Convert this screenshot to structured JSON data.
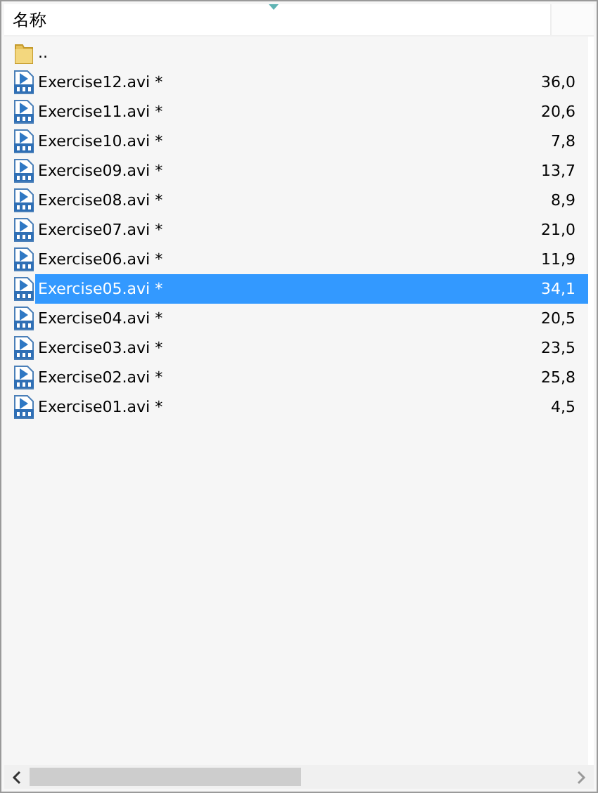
{
  "columns": [
    {
      "label": "名称"
    }
  ],
  "rows": [
    {
      "kind": "folder",
      "name": "..",
      "selected": false
    },
    {
      "kind": "video",
      "name": "Exercise12.avi *",
      "size": "36,0",
      "selected": false
    },
    {
      "kind": "video",
      "name": "Exercise11.avi *",
      "size": "20,6",
      "selected": false
    },
    {
      "kind": "video",
      "name": "Exercise10.avi *",
      "size": "7,8",
      "selected": false
    },
    {
      "kind": "video",
      "name": "Exercise09.avi *",
      "size": "13,7",
      "selected": false
    },
    {
      "kind": "video",
      "name": "Exercise08.avi *",
      "size": "8,9",
      "selected": false
    },
    {
      "kind": "video",
      "name": "Exercise07.avi *",
      "size": "21,0",
      "selected": false
    },
    {
      "kind": "video",
      "name": "Exercise06.avi *",
      "size": "11,9",
      "selected": false
    },
    {
      "kind": "video",
      "name": "Exercise05.avi *",
      "size": "34,1",
      "selected": true
    },
    {
      "kind": "video",
      "name": "Exercise04.avi *",
      "size": "20,5",
      "selected": false
    },
    {
      "kind": "video",
      "name": "Exercise03.avi *",
      "size": "23,5",
      "selected": false
    },
    {
      "kind": "video",
      "name": "Exercise02.avi *",
      "size": "25,8",
      "selected": false
    },
    {
      "kind": "video",
      "name": "Exercise01.avi *",
      "size": "4,5",
      "selected": false
    }
  ]
}
